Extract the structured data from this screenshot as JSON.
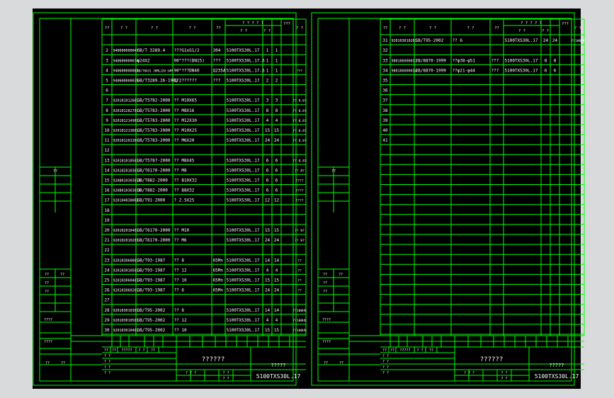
{
  "colors": {
    "background": "#d9dadc",
    "canvas": "#000000",
    "frame": "#00ff00",
    "text": "#ffffff"
  },
  "left_sheet": {
    "header": [
      "??",
      "? ?",
      "? ?",
      "? ?",
      "??",
      "? ? ? ? ?",
      "? ?",
      "? ?",
      "???",
      "? ?"
    ],
    "rows": [
      {
        "n": "",
        "code": "",
        "std": "",
        "name": "",
        "mat": "",
        "model": "",
        "q1": "",
        "q2": "",
        "note": ""
      },
      {
        "n": "2",
        "code": "940600000047",
        "std": "GB/T 3289.4",
        "name": "???G1xG1/2",
        "mat": "304",
        "model": "5100TXS30L.17",
        "q1": "1",
        "q2": "1",
        "note": ""
      },
      {
        "n": "3",
        "code": "940600000074",
        "std": "φ24X2",
        "name": "90°???(DN15)",
        "mat": "???",
        "model": "5100TXS30L.17.6",
        "q1": "1",
        "q2": "1",
        "note": ""
      },
      {
        "n": "4",
        "code": "940600000083",
        "std": "KB/T0431 JKMLJ20 S4M",
        "name": "90°???DN40",
        "mat": "Q235A",
        "model": "5100TXS30L.17.6",
        "q1": "1",
        "q2": "1",
        "note": "???"
      },
      {
        "n": "5",
        "code": "940600000035",
        "std": "GB/T3289.26-1982",
        "name": "1/2??????",
        "mat": "???",
        "model": "5100TXS30L.17",
        "q1": "2",
        "q2": "2",
        "note": ""
      },
      {
        "n": "6",
        "code": "",
        "std": "",
        "name": "",
        "mat": "",
        "model": "",
        "q1": "",
        "q2": "",
        "note": ""
      },
      {
        "n": "7",
        "code": "920101012601",
        "std": "GB/T5782-2000",
        "name": "?? M10X65",
        "mat": "",
        "model": "5100TXS30L.17",
        "q1": "3",
        "q2": "3",
        "note": "?? 8.8?"
      },
      {
        "n": "8",
        "code": "920101282701",
        "std": "GB/T5783-2000",
        "name": "?? M8X16",
        "mat": "",
        "model": "5100TXS30L.17",
        "q1": "8",
        "q2": "8",
        "note": "?? 8.8?"
      },
      {
        "n": "9",
        "code": "920101214901",
        "std": "GB/T5783-2000",
        "name": "?? M12X30",
        "mat": "",
        "model": "5100TXS30L.17",
        "q1": "4",
        "q2": "4",
        "note": "?? 8.8?"
      },
      {
        "n": "10",
        "code": "920101213601",
        "std": "GB/T5783-2000",
        "name": "?? M10X25",
        "mat": "",
        "model": "5100TXS30L.17",
        "q1": "15",
        "q2": "15",
        "note": "?? 8.8?"
      },
      {
        "n": "11",
        "code": "920101201301",
        "std": "GB/T5783-2000",
        "name": "?? M6X20",
        "mat": "",
        "model": "5100TXS30L.17",
        "q1": "24",
        "q2": "24",
        "note": "?? 8.8?"
      },
      {
        "n": "12",
        "code": "",
        "std": "",
        "name": "",
        "mat": "",
        "model": "",
        "q1": "",
        "q2": "",
        "note": ""
      },
      {
        "n": "13",
        "code": "920101010501",
        "std": "GB/T5787-2000",
        "name": "?? M8X45",
        "mat": "",
        "model": "5100TXS30L.17",
        "q1": "6",
        "q2": "6",
        "note": "?? 8.8?"
      },
      {
        "n": "14",
        "code": "920102010301",
        "std": "GB/T6170-2000",
        "name": "?? M8",
        "mat": "",
        "model": "5100TXS30L.17",
        "q1": "6",
        "q2": "6",
        "note": "?? 8?"
      },
      {
        "n": "15",
        "code": "920801030301A",
        "std": "GB/T882-2000",
        "name": "?? B10X32",
        "mat": "",
        "model": "5100TXS30L.17",
        "q1": "6",
        "q2": "6",
        "note": "????"
      },
      {
        "n": "16",
        "code": "920801030301A",
        "std": "GB/T882-2000",
        "name": "?? B8X32",
        "mat": "",
        "model": "5100TXS30L.17",
        "q1": "6",
        "q2": "6",
        "note": "????"
      },
      {
        "n": "17",
        "code": "920104030002",
        "std": "GB/T91-2000",
        "name": "? 2.5X25",
        "mat": "",
        "model": "5100TXS30L.17",
        "q1": "12",
        "q2": "12",
        "note": "????"
      },
      {
        "n": "18",
        "code": "",
        "std": "",
        "name": "",
        "mat": "",
        "model": "",
        "q1": "",
        "q2": "",
        "note": ""
      },
      {
        "n": "19",
        "code": "",
        "std": "",
        "name": "",
        "mat": "",
        "model": "",
        "q1": "",
        "q2": "",
        "note": ""
      },
      {
        "n": "20",
        "code": "920102010401",
        "std": "GB/T6170-2000",
        "name": "?? M10",
        "mat": "",
        "model": "5100TXS30L.17",
        "q1": "15",
        "q2": "15",
        "note": "?? 8?"
      },
      {
        "n": "21",
        "code": "920102010201",
        "std": "GB/T6170-2000",
        "name": "?? M6",
        "mat": "",
        "model": "5100TXS30L.17",
        "q1": "24",
        "q2": "24",
        "note": "?? 8?"
      },
      {
        "n": "22",
        "code": "",
        "std": "",
        "name": "",
        "mat": "",
        "model": "",
        "q1": "",
        "q2": "",
        "note": ""
      },
      {
        "n": "23",
        "code": "920103060801",
        "std": "GB/T93-1987",
        "name": "?? 8",
        "mat": "65Mn",
        "model": "5100TXS30L.17",
        "q1": "14",
        "q2": "14",
        "note": "??"
      },
      {
        "n": "24",
        "code": "920103010501",
        "std": "GB/T93-1987",
        "name": "?? 12",
        "mat": "65Mn",
        "model": "5100TXS30L.17",
        "q1": "4",
        "q2": "4",
        "note": "??"
      },
      {
        "n": "25",
        "code": "920103060401",
        "std": "GB/T93-1987",
        "name": "?? 10",
        "mat": "65Mn",
        "model": "5100TXS30L.17",
        "q1": "15",
        "q2": "15",
        "note": "??"
      },
      {
        "n": "26",
        "code": "920103060201",
        "std": "GB/T93-1987",
        "name": "?? 6",
        "mat": "65Mn",
        "model": "5100TXS30L.17",
        "q1": "24",
        "q2": "24",
        "note": "??"
      },
      {
        "n": "27",
        "code": "",
        "std": "",
        "name": "",
        "mat": "",
        "model": "",
        "q1": "",
        "q2": "",
        "note": ""
      },
      {
        "n": "28",
        "code": "920103010301",
        "std": "GB/T95-2002",
        "name": "?? 8",
        "mat": "",
        "model": "5100TXS30L.17",
        "q1": "14",
        "q2": "14",
        "note": "??100HV"
      },
      {
        "n": "29",
        "code": "920103010501",
        "std": "GB/T95-2002",
        "name": "?? 12",
        "mat": "",
        "model": "5100TXS30L.17",
        "q1": "4",
        "q2": "4",
        "note": "??100HV"
      },
      {
        "n": "30",
        "code": "920103010401",
        "std": "GB/T95-2002",
        "name": "?? 10",
        "mat": "",
        "model": "5100TXS30L.17",
        "q1": "15",
        "q2": "15",
        "note": "??100HV"
      }
    ],
    "side_labels": {
      "a": "??",
      "b": "??",
      "c": "??",
      "d": "??",
      "e": "??",
      "f": "????",
      "g": "????"
    },
    "title_block": {
      "drawing_name": "??????",
      "company": "?????",
      "drawing_no": "5100TXS30L.17",
      "sub": [
        "??",
        "??",
        "?????",
        "? ?",
        "??"
      ],
      "roles": [
        "? ?",
        "? ?",
        "? ?",
        "? ?"
      ],
      "scale": [
        "? ? ?",
        "? ?",
        "? ?"
      ],
      "left_labels": [
        "??",
        "??"
      ]
    }
  },
  "right_sheet": {
    "header": [
      "??",
      "? ?",
      "? ?",
      "? ?",
      "??",
      "? ? ? ? ?",
      "? ?",
      "? ?",
      "???",
      "? ?"
    ],
    "rows": [
      {
        "n": "31",
        "code": "920103010201",
        "std": "GB/T95-2002",
        "name": "?? 6",
        "mat": "",
        "model": "5100TXS30L.17",
        "q1": "24",
        "q2": "24",
        "note": "??100HV"
      },
      {
        "n": "32",
        "code": "",
        "std": "",
        "name": "",
        "mat": "",
        "model": "",
        "q1": "",
        "q2": "",
        "note": ""
      },
      {
        "n": "33",
        "code": "980106000011",
        "std": "JB/8870-1999",
        "name": "??φ38-φ51",
        "mat": "???",
        "model": "5100TXS30L.17",
        "q1": "8",
        "q2": "8",
        "note": ""
      },
      {
        "n": "34",
        "code": "980106000014",
        "std": "JB/8870-1999",
        "name": "??φ21-φ44",
        "mat": "???",
        "model": "5100TXS30L.17",
        "q1": "6",
        "q2": "6",
        "note": ""
      },
      {
        "n": "35",
        "code": "",
        "std": "",
        "name": "",
        "mat": "",
        "model": "",
        "q1": "",
        "q2": "",
        "note": ""
      },
      {
        "n": "36",
        "code": "",
        "std": "",
        "name": "",
        "mat": "",
        "model": "",
        "q1": "",
        "q2": "",
        "note": ""
      },
      {
        "n": "37",
        "code": "",
        "std": "",
        "name": "",
        "mat": "",
        "model": "",
        "q1": "",
        "q2": "",
        "note": ""
      },
      {
        "n": "38",
        "code": "",
        "std": "",
        "name": "",
        "mat": "",
        "model": "",
        "q1": "",
        "q2": "",
        "note": ""
      },
      {
        "n": "39",
        "code": "",
        "std": "",
        "name": "",
        "mat": "",
        "model": "",
        "q1": "",
        "q2": "",
        "note": ""
      },
      {
        "n": "40",
        "code": "",
        "std": "",
        "name": "",
        "mat": "",
        "model": "",
        "q1": "",
        "q2": "",
        "note": ""
      },
      {
        "n": "41",
        "code": "",
        "std": "",
        "name": "",
        "mat": "",
        "model": "",
        "q1": "",
        "q2": "",
        "note": ""
      }
    ],
    "side_labels": {
      "a": "??",
      "b": "??",
      "c": "??",
      "d": "??",
      "e": "??",
      "f": "????",
      "g": "????"
    },
    "title_block": {
      "drawing_name": "??????",
      "company": "?????",
      "drawing_no": "5100TXS30L.17",
      "sub": [
        "??",
        "??",
        "?????",
        "? ?",
        "??"
      ],
      "roles": [
        "? ?",
        "? ?",
        "? ?",
        "? ?"
      ],
      "scale": [
        "? ? ?",
        "? ?",
        "? ?"
      ],
      "left_labels": [
        "??",
        "??"
      ]
    }
  }
}
